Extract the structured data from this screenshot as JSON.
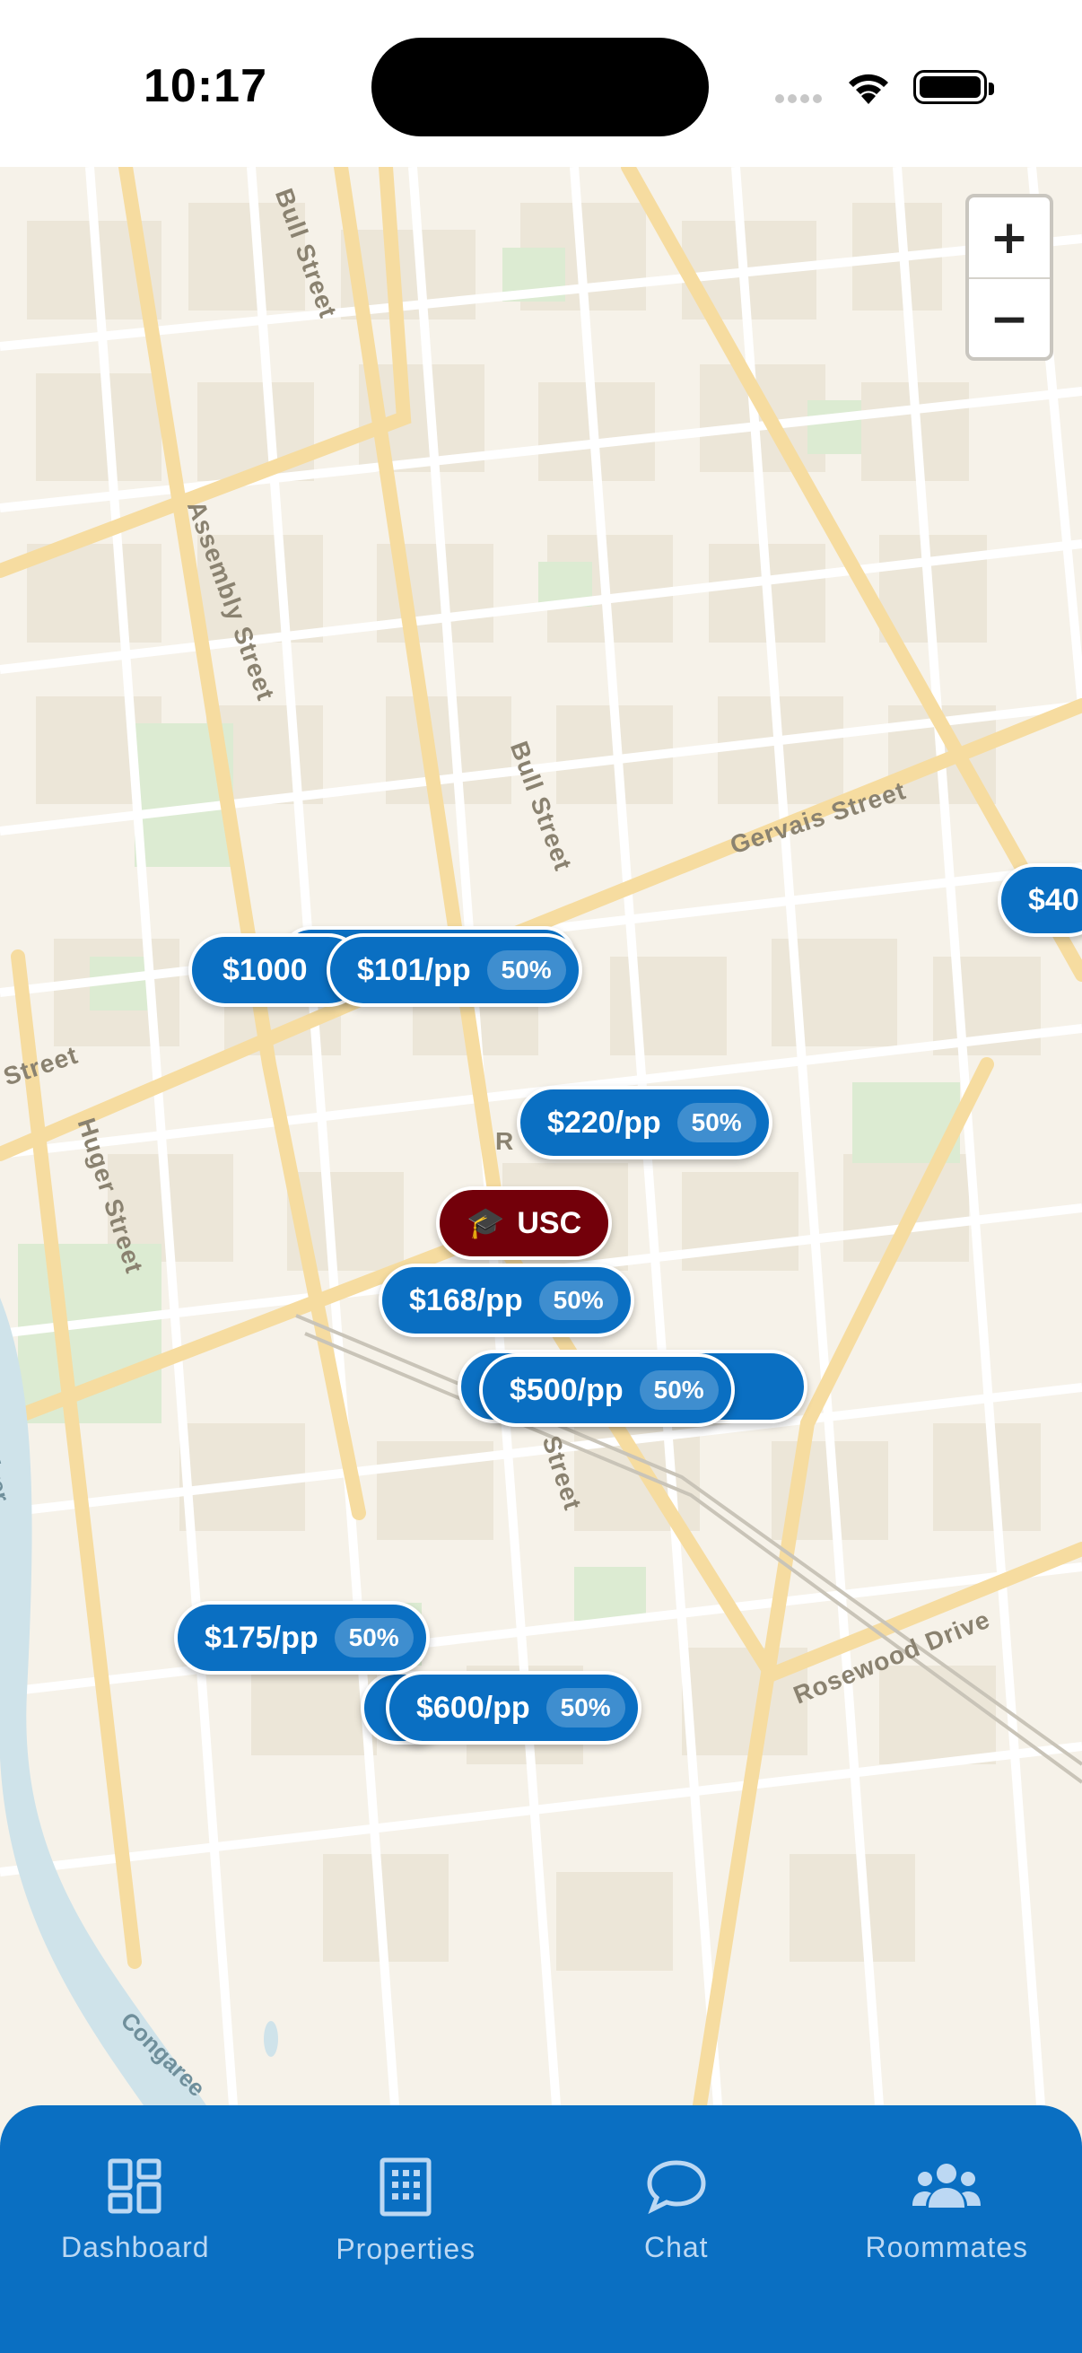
{
  "status_bar": {
    "time": "10:17"
  },
  "map": {
    "zoom_in_label": "+",
    "zoom_out_label": "−",
    "streets": {
      "bull_top": "Bull Street",
      "assembly": "Assembly Street",
      "bull_mid": "Bull Street",
      "gervais": "Gervais Street",
      "huger": "Huger Street",
      "street_left": "Street",
      "street_bottom": "Street",
      "rosewood": "Rosewood Drive",
      "congaree": "Congaree",
      "river": "River",
      "r_fragment": "R"
    }
  },
  "pins": [
    {
      "price": "$1000",
      "percent": ""
    },
    {
      "price": "$101/pp",
      "percent": "50%"
    },
    {
      "price": "$40",
      "percent": ""
    },
    {
      "price": "$220/pp",
      "percent": "50%"
    },
    {
      "price": "$168/pp",
      "percent": "50%"
    },
    {
      "price": "$500/pp",
      "percent": "50%"
    },
    {
      "price": "$175/pp",
      "percent": "50%"
    },
    {
      "price": "$600/pp",
      "percent": "50%"
    }
  ],
  "usc_marker": {
    "label": "USC",
    "icon": "graduation-cap-icon"
  },
  "tabs": [
    {
      "label": "Dashboard",
      "icon": "dashboard-grid-icon"
    },
    {
      "label": "Properties",
      "icon": "building-icon"
    },
    {
      "label": "Chat",
      "icon": "chat-bubble-icon"
    },
    {
      "label": "Roommates",
      "icon": "people-icon"
    }
  ],
  "colors": {
    "primary": "#0a6fc2",
    "usc": "#73000a",
    "map_background": "#f6f2e9"
  }
}
